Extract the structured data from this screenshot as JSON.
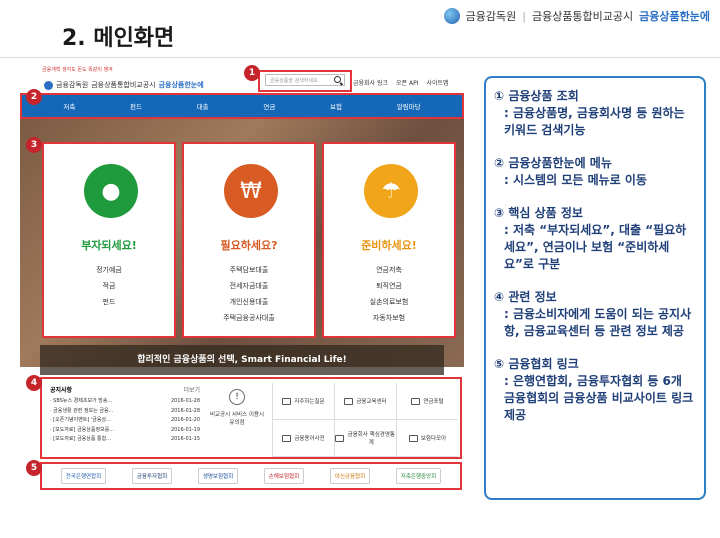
{
  "slide": {
    "title": "2. 메인화면",
    "brand": {
      "org": "금융감독원",
      "site": "금융상품통합비교공시",
      "accent": "금융상품한눈에"
    }
  },
  "site": {
    "tiny_brand": "금융개혁 생각도 돈도 똑같이 챙겨",
    "logo": {
      "org": "금융감독원",
      "site": "금융상품통합비교공시",
      "accent": "금융상품한눈에"
    },
    "search_placeholder": "금융상품을 검색하세요",
    "util_links": [
      "금융회사 링크",
      "오픈 API",
      "사이트맵"
    ],
    "nav": [
      "저축",
      "펀드",
      "대출",
      "연금",
      "보험",
      "알림마당"
    ],
    "cards": [
      {
        "head": "부자되세요!",
        "items": [
          "정기예금",
          "적금",
          "펀드"
        ],
        "color": "#1f9a3c"
      },
      {
        "head": "필요하세요?",
        "items": [
          "주택담보대출",
          "전세자금대출",
          "개인신용대출",
          "주택금융공사대출"
        ],
        "color": "#d75b23"
      },
      {
        "head": "준비하세요!",
        "items": [
          "연금저축",
          "퇴직연금",
          "실손의료보험",
          "자동차보험"
        ],
        "color": "#f1a51b"
      }
    ],
    "tagline": "합리적인 금융상품의 선택, Smart Financial Life!",
    "notice": {
      "title": "공지사항",
      "more": "더보기",
      "rows": [
        {
          "text": "· SBS뉴스 경제초보가 방송...",
          "date": "2016-01-28"
        },
        {
          "text": "· 금융생활 관련 정보는 금융...",
          "date": "2016-01-28"
        },
        {
          "text": "· [오픈기념이벤트] '금융상...",
          "date": "2016-01-20"
        },
        {
          "text": "· [보도자료] 금융상품정보를...",
          "date": "2016-01-19"
        },
        {
          "text": "· [보도자료] 금융상품 통합...",
          "date": "2016-01-15"
        }
      ]
    },
    "service": "비교공시 서비스 이용시 유의점",
    "quick": [
      "자주하는질문",
      "금융교육센터",
      "연금포털",
      "금융용어사전",
      "금융회사 핵심경영통계",
      "보험다모아"
    ],
    "associations": [
      "전국은행연합회",
      "금융투자협회",
      "생명보험협회",
      "손해보험협회",
      "여신금융협회",
      "저축은행중앙회"
    ]
  },
  "markers": [
    "1",
    "2",
    "3",
    "4",
    "5"
  ],
  "description": [
    {
      "head": "① 금융상품 조회",
      "body": ": 금융상품명, 금융회사명 등 원하는 키워드 검색기능"
    },
    {
      "head": "② 금융상품한눈에 메뉴",
      "body": ": 시스템의 모든 메뉴로 이동"
    },
    {
      "head": "③ 핵심 상품 정보",
      "body": ": 저축 “부자되세요”, 대출 “필요하세요”, 연금이나 보험 “준비하세요”로 구분"
    },
    {
      "head": "④ 관련 정보",
      "body": ": 금융소비자에게 도움이 되는 공지사항, 금융교육센터 등 관련 정보 제공"
    },
    {
      "head": "⑤ 금융협회 링크",
      "body": ": 은행연합회, 금융투자협회 등 6개 금융협회의 금융상품 비교사이트 링크 제공"
    }
  ]
}
